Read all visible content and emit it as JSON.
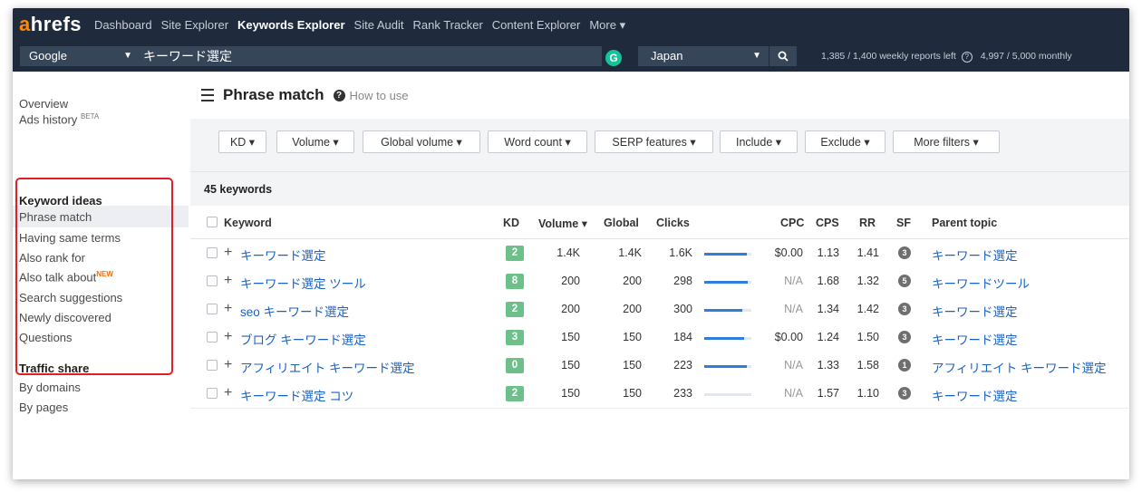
{
  "brand": {
    "logo_a": "a",
    "logo_rest": "hrefs"
  },
  "nav": [
    "Dashboard",
    "Site Explorer",
    "Keywords Explorer",
    "Site Audit",
    "Rank Tracker",
    "Content Explorer",
    "More ▾"
  ],
  "search": {
    "engine": "Google",
    "query": "キーワード選定",
    "grammarly_letter": "G",
    "country": "Japan",
    "reports": "1,385 / 1,400 weekly reports left",
    "monthly": "4,997 / 5,000 monthly"
  },
  "sidebar": {
    "overview": "Overview",
    "ads_history": "Ads history",
    "beta": "BETA",
    "keyword_ideas": "Keyword ideas",
    "phrase_match": "Phrase match",
    "having_same_terms": "Having same terms",
    "also_rank_for": "Also rank for",
    "also_talk_about": "Also talk about",
    "new_badge": "NEW",
    "search_suggestions": "Search suggestions",
    "newly_discovered": "Newly discovered",
    "questions": "Questions",
    "traffic_share": "Traffic share",
    "by_domains": "By domains",
    "by_pages": "By pages"
  },
  "main": {
    "title": "Phrase match",
    "how_to": "How to use",
    "keyword_count": "45 keywords"
  },
  "filters": [
    "KD ▾",
    "Volume ▾",
    "Global volume ▾",
    "Word count ▾",
    "SERP features ▾",
    "Include ▾",
    "Exclude ▾",
    "More filters ▾"
  ],
  "columns": {
    "keyword": "Keyword",
    "kd": "KD",
    "volume": "Volume ▾",
    "global": "Global",
    "clicks": "Clicks",
    "cpc": "CPC",
    "cps": "CPS",
    "rr": "RR",
    "sf": "SF",
    "parent": "Parent topic"
  },
  "rows": [
    {
      "keyword": "キーワード選定",
      "kd": "2",
      "volume": "1.4K",
      "global": "1.4K",
      "clicks": "1.6K",
      "clicks_fill": 0.9,
      "cpc": "$0.00",
      "cps": "1.13",
      "rr": "1.41",
      "sf": "3",
      "parent": "キーワード選定"
    },
    {
      "keyword": "キーワード選定 ツール",
      "kd": "8",
      "volume": "200",
      "global": "200",
      "clicks": "298",
      "clicks_fill": 0.92,
      "cpc": "N/A",
      "cps": "1.68",
      "rr": "1.32",
      "sf": "5",
      "parent": "キーワードツール"
    },
    {
      "keyword": "seo キーワード選定",
      "kd": "2",
      "volume": "200",
      "global": "200",
      "clicks": "300",
      "clicks_fill": 0.8,
      "cpc": "N/A",
      "cps": "1.34",
      "rr": "1.42",
      "sf": "3",
      "parent": "キーワード選定"
    },
    {
      "keyword": "ブログ キーワード選定",
      "kd": "3",
      "volume": "150",
      "global": "150",
      "clicks": "184",
      "clicks_fill": 0.85,
      "cpc": "$0.00",
      "cps": "1.24",
      "rr": "1.50",
      "sf": "3",
      "parent": "キーワード選定"
    },
    {
      "keyword": "アフィリエイト キーワード選定",
      "kd": "0",
      "volume": "150",
      "global": "150",
      "clicks": "223",
      "clicks_fill": 0.9,
      "cpc": "N/A",
      "cps": "1.33",
      "rr": "1.58",
      "sf": "1",
      "parent": "アフィリエイト キーワード選定"
    },
    {
      "keyword": "キーワード選定 コツ",
      "kd": "2",
      "volume": "150",
      "global": "150",
      "clicks": "233",
      "clicks_fill": 0.0,
      "cpc": "N/A",
      "cps": "1.57",
      "rr": "1.10",
      "sf": "3",
      "parent": "キーワード選定"
    }
  ]
}
